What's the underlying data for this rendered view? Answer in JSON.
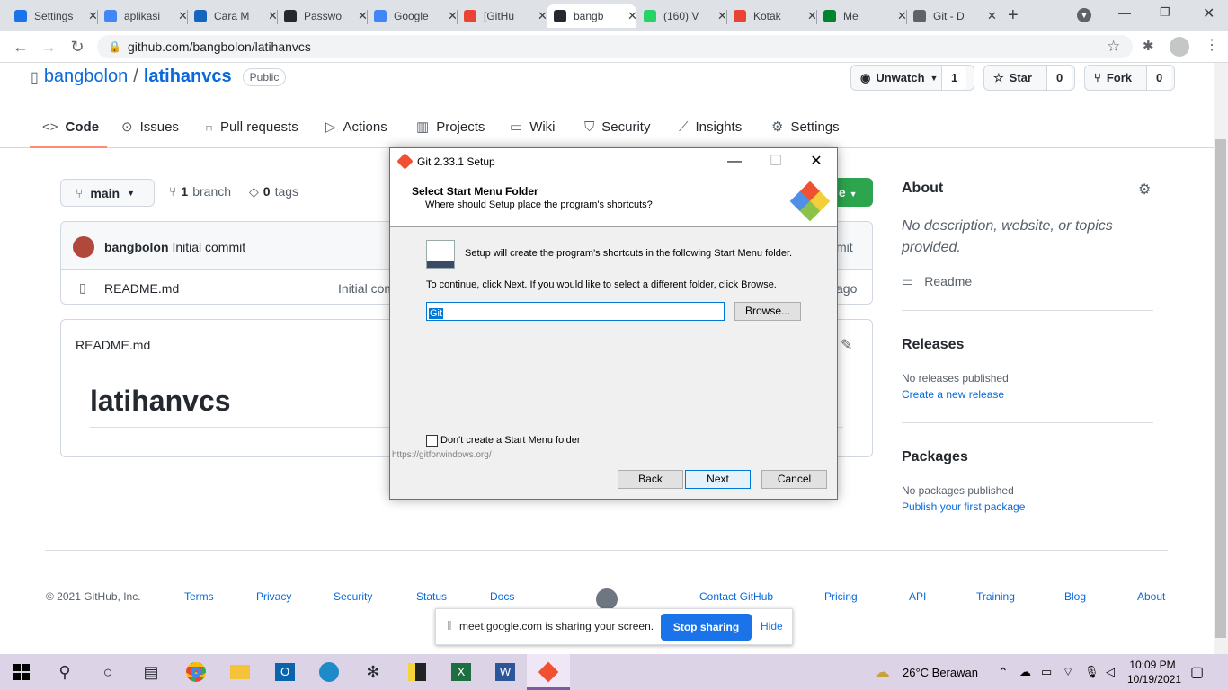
{
  "browser": {
    "tabs": [
      {
        "title": "Settings",
        "color": "#1a73e8",
        "active": false
      },
      {
        "title": "aplikasi",
        "color": "#4285f4",
        "active": false
      },
      {
        "title": "Cara M",
        "color": "#1565c0",
        "active": false
      },
      {
        "title": "Passwo",
        "color": "#24292f",
        "active": false
      },
      {
        "title": "Google",
        "color": "#4285f4",
        "active": false
      },
      {
        "title": "[GitHu",
        "color": "#ea4335",
        "active": false
      },
      {
        "title": "bangb",
        "color": "#24292f",
        "active": true
      },
      {
        "title": "(160) V",
        "color": "#25d366",
        "active": false
      },
      {
        "title": "Kotak",
        "color": "#ea4335",
        "active": false
      },
      {
        "title": "Me",
        "color": "#00832d",
        "active": false
      },
      {
        "title": "Git - D",
        "color": "#5f6368",
        "active": false
      }
    ],
    "close_glyph": "✕",
    "new_tab": "+",
    "url": "github.com/bangbolon/latihanvcs"
  },
  "repo": {
    "owner": "bangbolon",
    "separator": "/",
    "name": "latihanvcs",
    "visibility": "Public",
    "unwatch_label": "Unwatch",
    "watch_count": "1",
    "star_label": "Star",
    "star_count": "0",
    "fork_label": "Fork",
    "fork_count": "0"
  },
  "nav": {
    "code": "Code",
    "issues": "Issues",
    "pulls": "Pull requests",
    "actions": "Actions",
    "projects": "Projects",
    "wiki": "Wiki",
    "security": "Security",
    "insights": "Insights",
    "settings": "Settings"
  },
  "files": {
    "branch": "main",
    "branches_count": "1",
    "branches_label": "branch",
    "tags_count": "0",
    "tags_label": "tags",
    "code_btn_partial": "le",
    "commit_author": "bangbolon",
    "commit_message": "Initial commit",
    "commit_right_partial": "mit",
    "file_name": "README.md",
    "file_commit_partial": "Initial com",
    "file_time_partial": "ago",
    "readme_header": "README.md",
    "readme_h1": "latihanvcs"
  },
  "about": {
    "heading": "About",
    "description": "No description, website, or topics provided.",
    "readme": "Readme",
    "releases_heading": "Releases",
    "releases_text": "No releases published",
    "releases_link": "Create a new release",
    "packages_heading": "Packages",
    "packages_text": "No packages published",
    "packages_link": "Publish your first package"
  },
  "footer": {
    "copyright": "© 2021 GitHub, Inc.",
    "left_links": [
      "Terms",
      "Privacy",
      "Security",
      "Status",
      "Docs"
    ],
    "right_links": [
      "Contact GitHub",
      "Pricing",
      "API",
      "Training",
      "Blog",
      "About"
    ]
  },
  "dialog": {
    "title": "Git 2.33.1 Setup",
    "heading": "Select Start Menu Folder",
    "subheading": "Where should Setup place the program's shortcuts?",
    "info": "Setup will create the program's shortcuts in the following Start Menu folder.",
    "instruction": "To continue, click Next. If you would like to select a different folder, click Browse.",
    "folder_value": "Git",
    "browse": "Browse...",
    "checkbox_label": "Don't create a Start Menu folder",
    "url": "https://gitforwindows.org/",
    "back": "Back",
    "next": "Next",
    "cancel": "Cancel"
  },
  "share_bar": {
    "message": "meet.google.com is sharing your screen.",
    "stop": "Stop sharing",
    "hide": "Hide"
  },
  "taskbar": {
    "weather": "26°C  Berawan",
    "time": "10:09 PM",
    "date": "10/19/2021"
  }
}
